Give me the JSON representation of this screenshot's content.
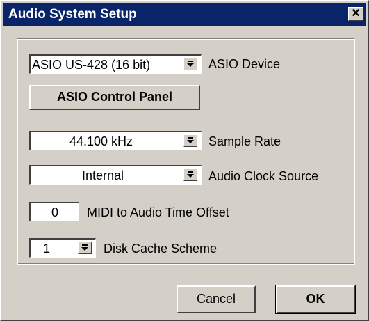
{
  "window": {
    "title": "Audio System Setup",
    "close_label": "✕"
  },
  "asio_device": {
    "value": "ASIO US-428 (16 bit)",
    "label": "ASIO Device"
  },
  "control_panel": {
    "label_pre": "ASIO Control ",
    "label_u": "P",
    "label_post": "anel"
  },
  "sample_rate": {
    "value": "44.100 kHz",
    "label": "Sample Rate"
  },
  "clock_source": {
    "value": "Internal",
    "label": "Audio Clock Source"
  },
  "midi_offset": {
    "value": "0",
    "label": "MIDI to Audio Time Offset"
  },
  "disk_cache": {
    "value": "1",
    "label": "Disk Cache Scheme"
  },
  "buttons": {
    "cancel_u": "C",
    "cancel_rest": "ancel",
    "ok_u": "O",
    "ok_rest": "K"
  },
  "icons": {
    "close": "close-icon",
    "dropdown": "dropdown-arrow-icon"
  }
}
